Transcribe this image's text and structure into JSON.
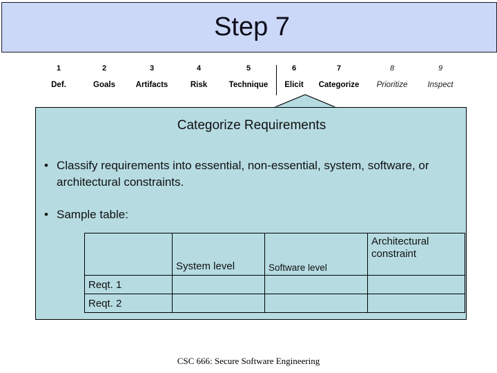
{
  "slide": {
    "title": "Step 7",
    "footer": "CSC 666: Secure Software Engineering",
    "accent_banner_color": "#ccd8f7",
    "panel_color": "#b6dce2"
  },
  "steps": [
    {
      "num": "1",
      "label": "Def.",
      "state": "done"
    },
    {
      "num": "2",
      "label": "Goals",
      "state": "done"
    },
    {
      "num": "3",
      "label": "Artifacts",
      "state": "done"
    },
    {
      "num": "4",
      "label": "Risk",
      "state": "done"
    },
    {
      "num": "5",
      "label": "Technique",
      "state": "done"
    },
    {
      "num": "6",
      "label": "Elicit",
      "state": "done"
    },
    {
      "num": "7",
      "label": "Categorize",
      "state": "current"
    },
    {
      "num": "8",
      "label": "Prioritize",
      "state": "future"
    },
    {
      "num": "9",
      "label": "Inspect",
      "state": "future"
    }
  ],
  "panel": {
    "heading": "Categorize Requirements",
    "bullet_glyph": "•",
    "bullets": [
      "Classify requirements into essential, non-essential, system, software, or architectural constraints.",
      "Sample table:"
    ]
  },
  "table": {
    "headers": [
      "",
      "System level",
      "Software level",
      "Architectural constraint"
    ],
    "rows": [
      [
        "Reqt. 1",
        "",
        "",
        ""
      ],
      [
        "Reqt. 2",
        "",
        "",
        ""
      ]
    ]
  }
}
